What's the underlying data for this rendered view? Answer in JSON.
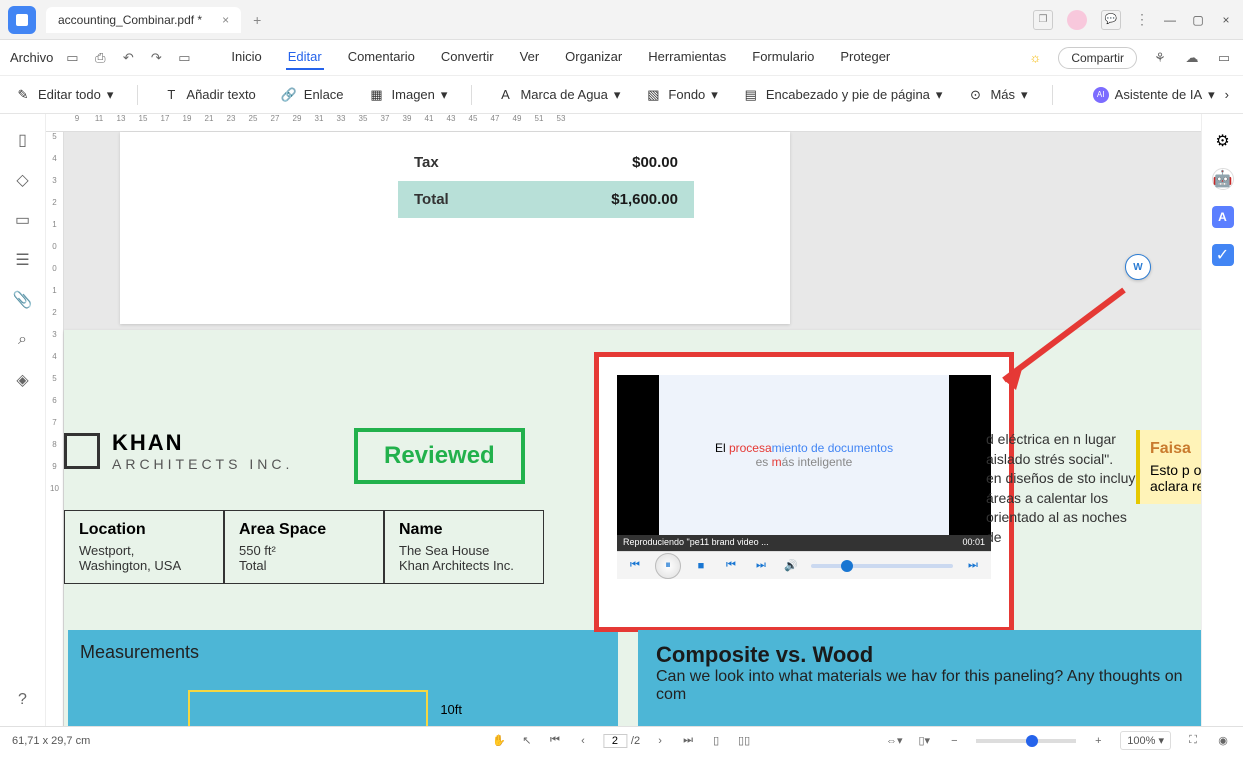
{
  "titlebar": {
    "tab_name": "accounting_Combinar.pdf *",
    "tab_close": "×",
    "add_tab": "+"
  },
  "window": {
    "min": "—",
    "max": "▢",
    "close": "×"
  },
  "menubar": {
    "file": "Archivo",
    "tabs": [
      "Inicio",
      "Editar",
      "Comentario",
      "Convertir",
      "Ver",
      "Organizar",
      "Herramientas",
      "Formulario",
      "Proteger"
    ],
    "active_index": 1,
    "share": "Compartir"
  },
  "toolbar": {
    "edit_all": "Editar todo",
    "add_text": "Añadir texto",
    "link": "Enlace",
    "image": "Imagen",
    "watermark": "Marca de Agua",
    "background": "Fondo",
    "header_footer": "Encabezado y pie de página",
    "more": "Más",
    "ai": "Asistente de IA"
  },
  "ruler_h": [
    "9",
    "11",
    "13",
    "15",
    "17",
    "19",
    "21",
    "23",
    "25",
    "27",
    "29",
    "31",
    "33",
    "35",
    "37",
    "39",
    "41",
    "43",
    "45",
    "47",
    "49",
    "51",
    "53"
  ],
  "ruler_v": [
    "5",
    "4",
    "3",
    "2",
    "1",
    "0",
    "0",
    "1",
    "2",
    "3",
    "4",
    "5",
    "6",
    "7",
    "8",
    "9",
    "10"
  ],
  "document": {
    "tax": {
      "label": "Tax",
      "value": "$00.00"
    },
    "total": {
      "label": "Total",
      "value": "$1,600.00"
    },
    "company": {
      "name": "KHAN",
      "sub": "ARCHITECTS INC."
    },
    "stamp": "Reviewed",
    "info": {
      "loc": {
        "h": "Location",
        "v1": "Westport,",
        "v2": "Washington, USA"
      },
      "area": {
        "h": "Area Space",
        "v1": "550 ft²",
        "v2": "Total"
      },
      "name": {
        "h": "Name",
        "v1": "The Sea House",
        "v2": "Khan Architects Inc."
      }
    },
    "meas": {
      "title": "Measurements",
      "ft": "10ft"
    },
    "video": {
      "line1a": "El ",
      "line1b": "procesa",
      "line1c": "miento de documentos",
      "line2a": "es ",
      "line2b": "m",
      "line2c": "ás inteligente",
      "status": "Reproduciendo \"pe11 brand video ...",
      "time": "00:01"
    },
    "side_text": "d eléctrica en n lugar aislado strés social\".\nen diseños de sto incluye áreas a calentar los orientado al as noches de",
    "sticky": {
      "author": "Faisa",
      "body": "Esto p otra re aclara revisa"
    },
    "composite": {
      "h": "Composite vs. Wood",
      "b": "Can we look into what materials we hav for this paneling? Any thoughts on com"
    }
  },
  "statusbar": {
    "pos": "61,71 x 29,7 cm",
    "page_current": "2",
    "page_total": "/2",
    "zoom": "100%"
  }
}
